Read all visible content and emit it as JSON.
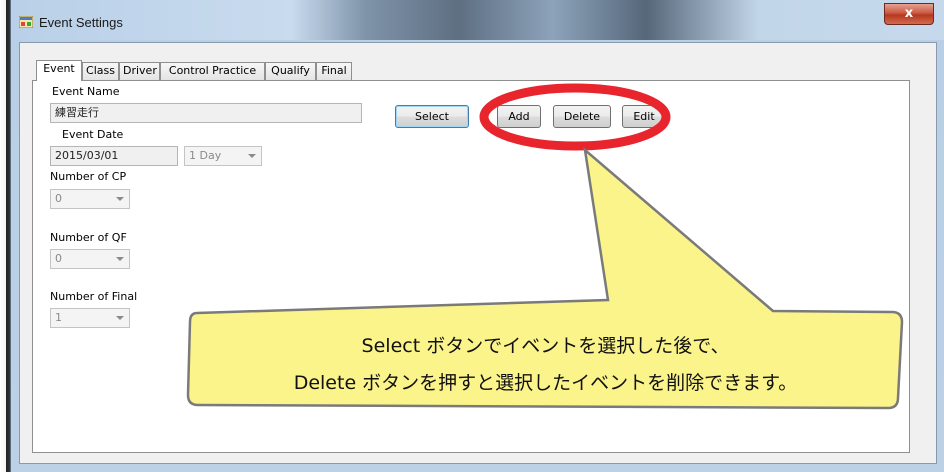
{
  "window": {
    "title": "Event Settings",
    "close_label": "x"
  },
  "tabs": [
    {
      "label": "Event"
    },
    {
      "label": "Class"
    },
    {
      "label": "Driver"
    },
    {
      "label": "Control Practice"
    },
    {
      "label": "Qualify"
    },
    {
      "label": "Final"
    }
  ],
  "form": {
    "event_name_label": "Event Name",
    "event_name_value": "練習走行",
    "event_date_label": "Event Date",
    "event_date_value": "2015/03/01",
    "duration_value": "1 Day",
    "cp_label": "Number of CP",
    "cp_value": "0",
    "qf_label": "Number of QF",
    "qf_value": "0",
    "final_label": "Number of Final",
    "final_value": "1"
  },
  "buttons": {
    "select": "Select",
    "add": "Add",
    "delete": "Delete",
    "edit": "Edit"
  },
  "annotation": {
    "line1": "Select ボタンでイベントを選択した後で、",
    "line2": "Delete ボタンを押すと選択したイベントを削除できます。",
    "highlight_color": "#e8242c",
    "callout_color": "#fbf48a"
  }
}
